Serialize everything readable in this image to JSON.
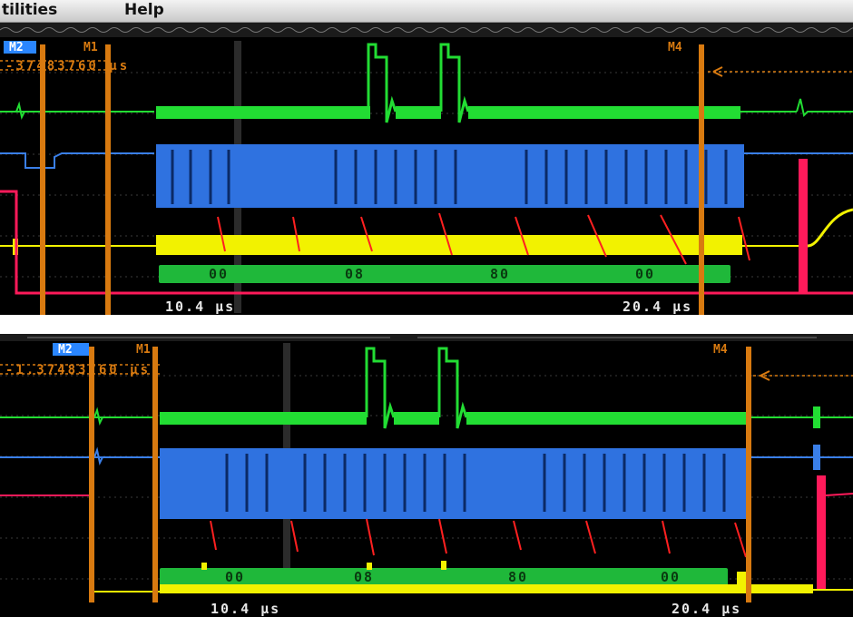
{
  "menu": {
    "items": [
      "tilities",
      "Help"
    ]
  },
  "top_panel": {
    "markers": {
      "m2": "M2",
      "m1": "M1",
      "m4": "M4"
    },
    "cursor_readout": "-37483760 µs",
    "time_labels": {
      "left": "10.4 µs",
      "right": "20.4 µs"
    },
    "decode_bytes": [
      "00",
      "08",
      "80",
      "00"
    ]
  },
  "bottom_panel": {
    "markers": {
      "m2": "M2",
      "m1": "M1",
      "m4": "M4"
    },
    "cursor_readout": "-1.37483760 µs",
    "time_labels": {
      "left": "10.4 µs",
      "right": "20.4 µs"
    },
    "decode_bytes": [
      "00",
      "08",
      "80",
      "00"
    ]
  },
  "colors": {
    "background": "#000000",
    "green_trace": "#22dd33",
    "blue_trace": "#3a7fe8",
    "yellow_trace": "#f2f200",
    "red_trace": "#ff1a5a",
    "cursor": "#d87a10",
    "marker_blue": "#2a86ff",
    "annotation": "#ff2020"
  }
}
